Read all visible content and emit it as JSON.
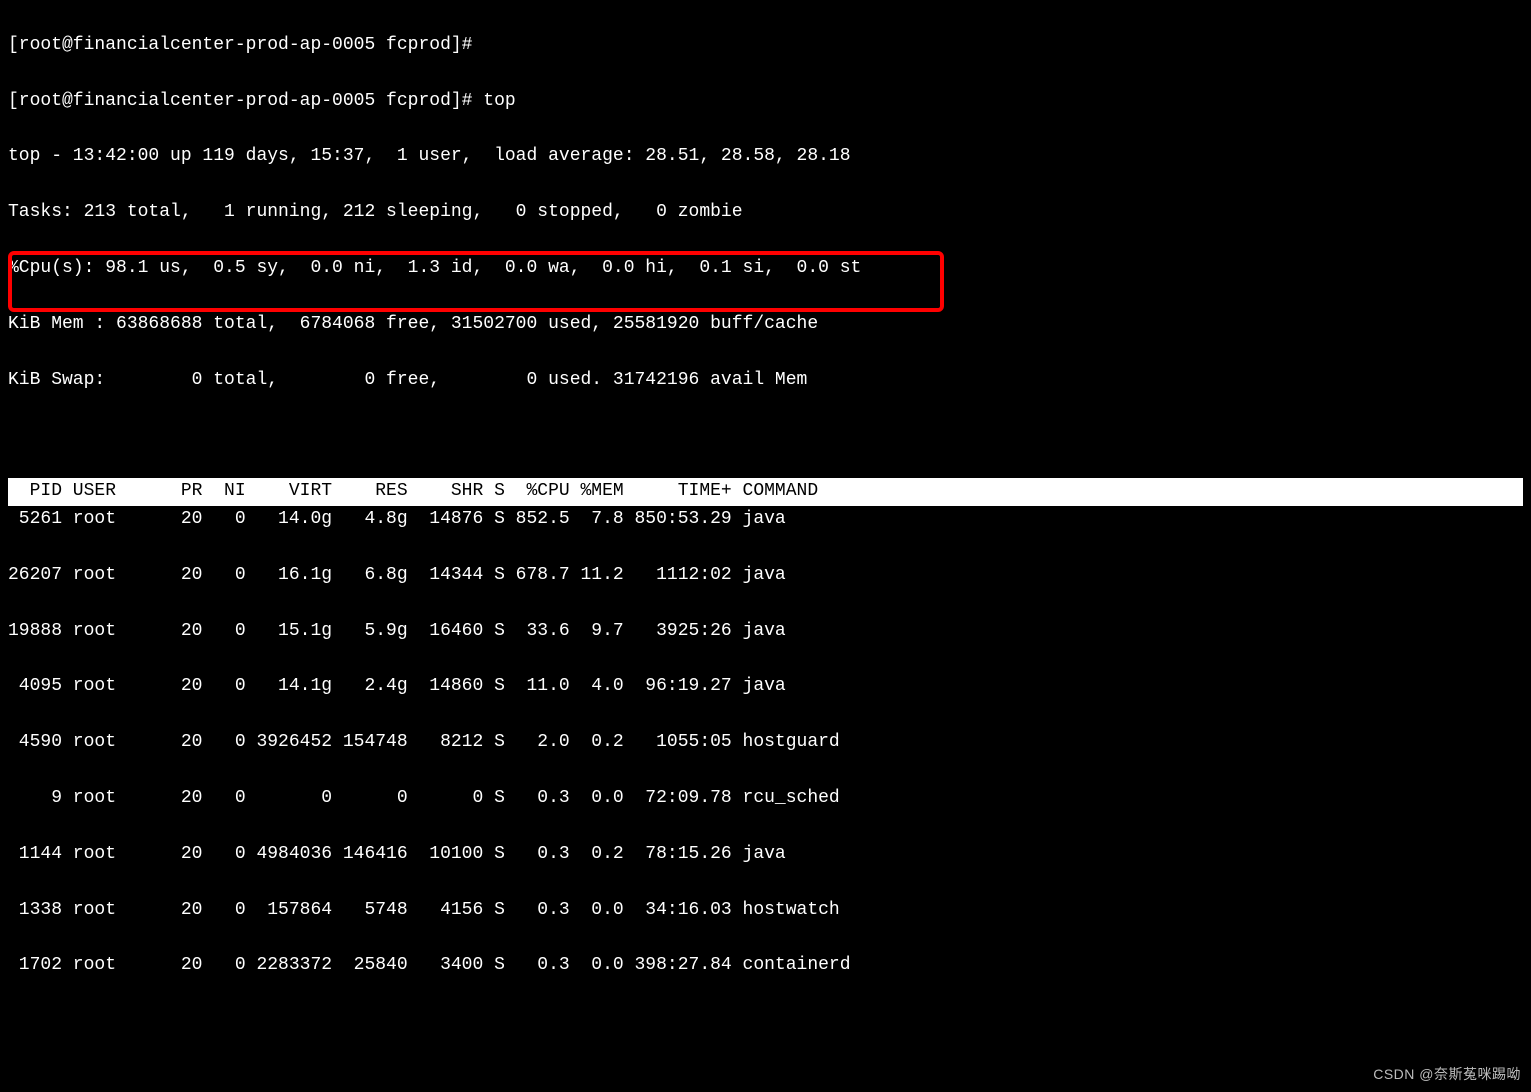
{
  "prompt1": "[root@financialcenter-prod-ap-0005 fcprod]#",
  "prompt2": "[root@financialcenter-prod-ap-0005 fcprod]# top",
  "summary": {
    "l1": "top - 13:42:00 up 119 days, 15:37,  1 user,  load average: 28.51, 28.58, 28.18",
    "l2": "Tasks: 213 total,   1 running, 212 sleeping,   0 stopped,   0 zombie",
    "l3": "%Cpu(s): 98.1 us,  0.5 sy,  0.0 ni,  1.3 id,  0.0 wa,  0.0 hi,  0.1 si,  0.0 st",
    "l4": "KiB Mem : 63868688 total,  6784068 free, 31502700 used, 25581920 buff/cache",
    "l5": "KiB Swap:        0 total,        0 free,        0 used. 31742196 avail Mem"
  },
  "header": "  PID USER      PR  NI    VIRT    RES    SHR S  %CPU %MEM     TIME+ COMMAND",
  "rows": [
    " 5261 root      20   0   14.0g   4.8g  14876 S 852.5  7.8 850:53.29 java",
    "26207 root      20   0   16.1g   6.8g  14344 S 678.7 11.2   1112:02 java",
    "19888 root      20   0   15.1g   5.9g  16460 S  33.6  9.7   3925:26 java",
    " 4095 root      20   0   14.1g   2.4g  14860 S  11.0  4.0  96:19.27 java",
    " 4590 root      20   0 3926452 154748   8212 S   2.0  0.2   1055:05 hostguard",
    "    9 root      20   0       0      0      0 S   0.3  0.0  72:09.78 rcu_sched",
    " 1144 root      20   0 4984036 146416  10100 S   0.3  0.2  78:15.26 java",
    " 1338 root      20   0  157864   5748   4156 S   0.3  0.0  34:16.03 hostwatch",
    " 1702 root      20   0 2283372  25840   3400 S   0.3  0.0 398:27.84 containerd"
  ],
  "watermark": "CSDN @奈斯菟咪踢呦"
}
